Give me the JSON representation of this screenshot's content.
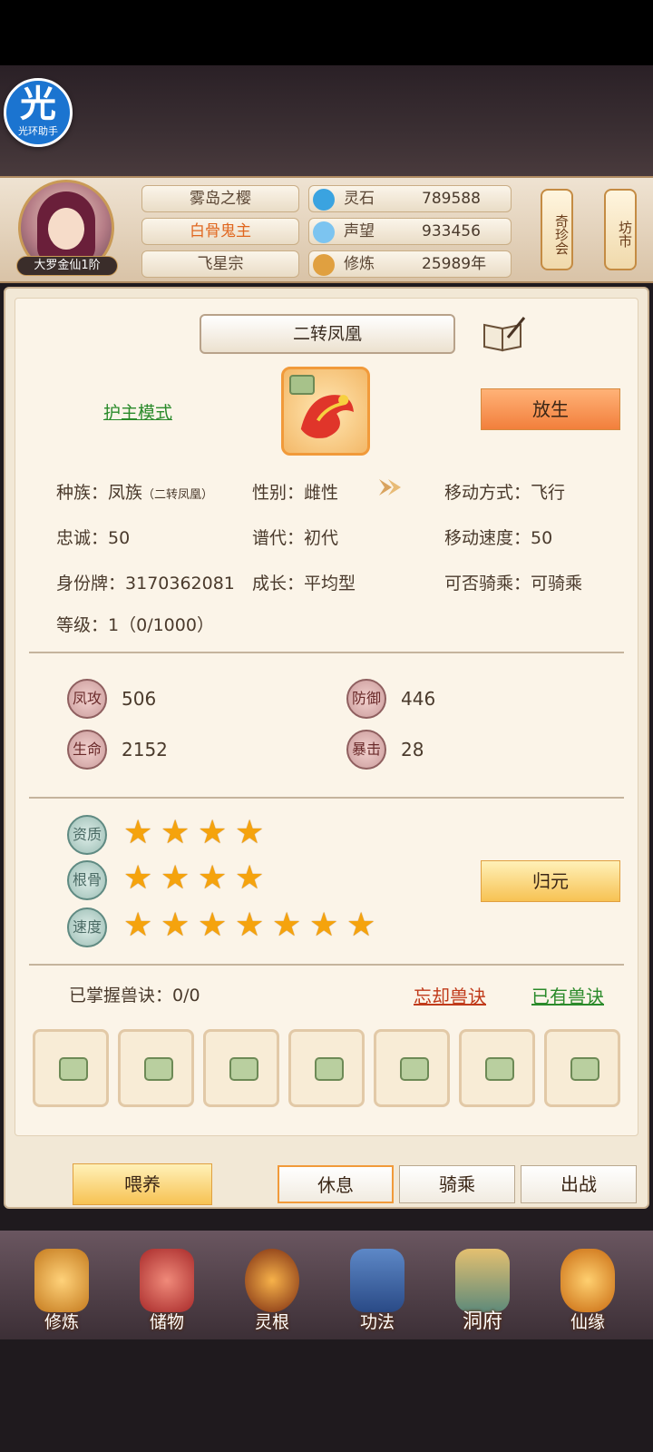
{
  "helper": {
    "big": "光",
    "small": "光环助手"
  },
  "player": {
    "rank": "大罗金仙1阶",
    "name": "雾岛之樱",
    "title": "白骨鬼主",
    "sect": "飞星宗"
  },
  "resources": [
    {
      "label": "灵石",
      "value": "789588",
      "icon": "spirit-stone-icon",
      "color": "#3aa3e0"
    },
    {
      "label": "声望",
      "value": "933456",
      "icon": "prestige-icon",
      "color": "#7cc4f0"
    },
    {
      "label": "修炼",
      "value": "25989年",
      "icon": "cultivation-icon",
      "color": "#e0a040"
    }
  ],
  "lanterns": {
    "left": "奇珍会",
    "right": "坊市"
  },
  "pet": {
    "name": "二转凤凰",
    "guard_mode": "护主模式",
    "release_label": "放生",
    "info": {
      "race_label": "种族：",
      "race_value": "凤族",
      "race_sub": "（二转凤凰）",
      "gender_label": "性别：",
      "gender_value": "雌性",
      "move_label": "移动方式：",
      "move_value": "飞行",
      "loyalty_label": "忠诚：",
      "loyalty_value": "50",
      "gen_label": "谱代：",
      "gen_value": "初代",
      "speed_label": "移动速度：",
      "speed_value": "50",
      "id_label": "身份牌：",
      "id_value": "3170362081",
      "growth_label": "成长：",
      "growth_value": "平均型",
      "ride_label": "可否骑乘：",
      "ride_value": "可骑乘",
      "level_label": "等级：",
      "level_value": "1（0/1000）"
    },
    "stats": [
      {
        "label": "凤攻",
        "value": "506"
      },
      {
        "label": "防御",
        "value": "446"
      },
      {
        "label": "生命",
        "value": "2152"
      },
      {
        "label": "暴击",
        "value": "28"
      }
    ],
    "ratings": [
      {
        "label": "资质",
        "stars": 4
      },
      {
        "label": "根骨",
        "stars": 4
      },
      {
        "label": "速度",
        "stars": 7
      }
    ],
    "reset_label": "归元",
    "mastered_label": "已掌握兽诀：",
    "mastered_value": "0/0",
    "forget_label": "忘却兽诀",
    "have_label": "已有兽诀"
  },
  "actions": {
    "feed": "喂养",
    "rest": "休息",
    "ride": "骑乘",
    "battle": "出战"
  },
  "nav": [
    {
      "label": "修炼",
      "icon": "cultivate-icon"
    },
    {
      "label": "储物",
      "icon": "storage-bag-icon"
    },
    {
      "label": "灵根",
      "icon": "spirit-root-icon"
    },
    {
      "label": "功法",
      "icon": "technique-book-icon"
    },
    {
      "label": "洞府",
      "icon": "cave-dwelling-icon"
    },
    {
      "label": "仙缘",
      "icon": "destiny-gourd-icon"
    }
  ]
}
